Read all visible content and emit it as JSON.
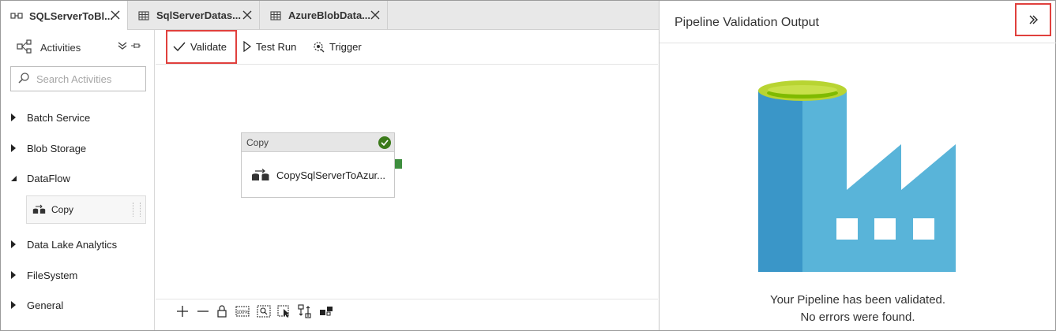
{
  "tabs": [
    {
      "label": "SQLServerToBl...",
      "icon": "pipeline-icon",
      "active": true
    },
    {
      "label": "SqlServerDatas...",
      "icon": "table-icon",
      "active": false
    },
    {
      "label": "AzureBlobData...",
      "icon": "table-icon",
      "active": false
    }
  ],
  "sidebar": {
    "title": "Activities",
    "search_placeholder": "Search Activities",
    "categories": [
      {
        "label": "Batch Service",
        "expanded": false
      },
      {
        "label": "Blob Storage",
        "expanded": false
      },
      {
        "label": "DataFlow",
        "expanded": true
      },
      {
        "label": "Data Lake Analytics",
        "expanded": false
      },
      {
        "label": "FileSystem",
        "expanded": false
      },
      {
        "label": "General",
        "expanded": false
      }
    ],
    "dataflow_items": [
      {
        "label": "Copy"
      }
    ]
  },
  "toolbar": {
    "validate_label": "Validate",
    "test_run_label": "Test Run",
    "trigger_label": "Trigger"
  },
  "canvas": {
    "node": {
      "type_label": "Copy",
      "name": "CopySqlServerToAzur..."
    }
  },
  "right_panel": {
    "title": "Pipeline Validation Output",
    "message_line1": "Your Pipeline has been validated.",
    "message_line2": "No errors were found."
  },
  "colors": {
    "highlight": "#e0403d",
    "factory_dark": "#3a96c8",
    "factory_light": "#59b4d9",
    "factory_top": "#b8d432",
    "success": "#3b7a1a"
  }
}
